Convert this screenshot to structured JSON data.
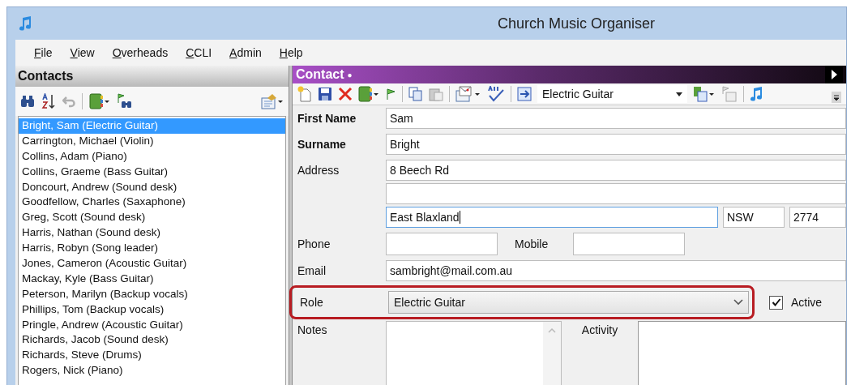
{
  "window": {
    "title": "Church Music Organiser"
  },
  "menu": [
    {
      "label": "File"
    },
    {
      "label": "View"
    },
    {
      "label": "Overheads"
    },
    {
      "label": "CCLI"
    },
    {
      "label": "Admin"
    },
    {
      "label": "Help"
    }
  ],
  "contacts": {
    "title": "Contacts",
    "items": [
      {
        "label": "Bright, Sam (Electric Guitar)",
        "selected": true
      },
      {
        "label": "Carrington, Michael (Violin)",
        "selected": false
      },
      {
        "label": "Collins, Adam (Piano)",
        "selected": false
      },
      {
        "label": "Collins, Graeme (Bass Guitar)",
        "selected": false
      },
      {
        "label": "Doncourt, Andrew (Sound desk)",
        "selected": false
      },
      {
        "label": "Goodfellow, Charles (Saxaphone)",
        "selected": false
      },
      {
        "label": "Greg, Scott (Sound desk)",
        "selected": false
      },
      {
        "label": "Harris, Nathan (Sound desk)",
        "selected": false
      },
      {
        "label": "Harris, Robyn (Song leader)",
        "selected": false
      },
      {
        "label": "Jones, Cameron (Acoustic Guitar)",
        "selected": false
      },
      {
        "label": "Mackay, Kyle (Bass Guitar)",
        "selected": false
      },
      {
        "label": "Peterson, Marilyn (Backup vocals)",
        "selected": false
      },
      {
        "label": "Phillips, Tom (Backup vocals)",
        "selected": false
      },
      {
        "label": "Pringle, Andrew (Acoustic Guitar)",
        "selected": false
      },
      {
        "label": "Richards, Jacob (Sound desk)",
        "selected": false
      },
      {
        "label": "Richards, Steve (Drums)",
        "selected": false
      },
      {
        "label": "Rogers, Nick (Piano)",
        "selected": false
      }
    ]
  },
  "contact": {
    "title": "Contact",
    "unsaved_mark": "●",
    "toolbar_role": "Electric Guitar",
    "first_name": {
      "label": "First Name",
      "value": "Sam",
      "required": true
    },
    "surname": {
      "label": "Surname",
      "value": "Bright",
      "required": true
    },
    "address": {
      "label": "Address",
      "line1": "8 Beech Rd",
      "suburb": "East Blaxland",
      "suburb_focused": true,
      "state": "NSW",
      "postcode": "2774"
    },
    "phone": {
      "label": "Phone"
    },
    "mobile": {
      "label": "Mobile"
    },
    "email": {
      "label": "Email",
      "value": "sambright@mail.com.au"
    },
    "role": {
      "label": "Role",
      "value": "Electric Guitar",
      "highlighted": true
    },
    "active": {
      "label": "Active",
      "checked": true
    },
    "notes": {
      "label": "Notes"
    },
    "activity": {
      "label": "Activity"
    }
  }
}
